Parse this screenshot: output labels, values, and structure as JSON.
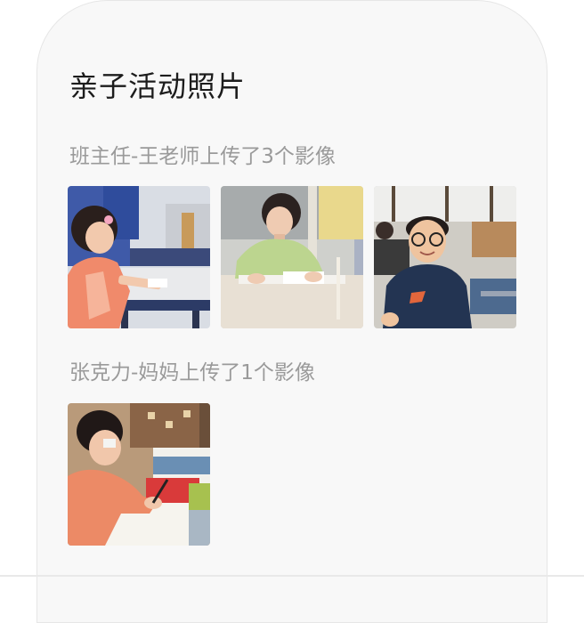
{
  "section": {
    "title": "亲子活动照片"
  },
  "groups": [
    {
      "uploader_text": "班主任-王老师上传了3个影像",
      "photos": [
        {
          "icon": "photo-girl-pink-jacket-writing"
        },
        {
          "icon": "photo-girl-green-shirt-writing"
        },
        {
          "icon": "photo-boy-glasses-smiling"
        }
      ]
    },
    {
      "uploader_text": "张克力-妈妈上传了1个影像",
      "photos": [
        {
          "icon": "photo-girl-orange-shirt-writing"
        }
      ]
    }
  ],
  "colors": {
    "card_bg": "#f8f8f8",
    "title": "#1c1c1c",
    "subtext": "#9a9a9a"
  }
}
